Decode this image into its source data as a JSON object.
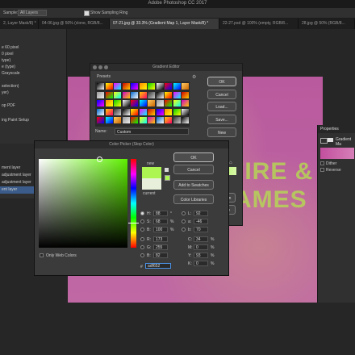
{
  "app": {
    "title": "Adobe Photoshop CC 2017",
    "options_bar": {
      "sample_label": "Sample:",
      "sample_value": "All Layers",
      "show_ring_label": "Show Sampling Ring"
    },
    "tabs": [
      "2, Layer Mask/8) *",
      "04-06.jpg @ 50% (clone, RGB/8...",
      "07-21.jpg @ 33.3% (Gradient Map 1, Layer Mask/8) *",
      "22-27.psd @ 100% (empty, RGB/8...",
      "28.jpg @ 50% (RGB/8..."
    ]
  },
  "left_panel": {
    "items": [
      "e 60 pixel",
      "0 pixel",
      "type)",
      "e (type)",
      "Grayscale",
      "selection)",
      "yer)",
      "op PDF",
      "ing Paint Setup"
    ],
    "layers": [
      "ment layer",
      "adjustment layer",
      "adjustment layer",
      "ent layer"
    ]
  },
  "canvas": {
    "text_line1": "FIRE &",
    "text_line2": "AMES",
    "colors": {
      "bg_top": "#b95a9e",
      "bg_bottom": "#bf68a4",
      "text": "#b6cf5a"
    }
  },
  "gradient_editor": {
    "title": "Gradient Editor",
    "presets_label": "Presets",
    "name_label": "Name:",
    "name_value": "Custom",
    "buttons": {
      "ok": "OK",
      "cancel": "Cancel",
      "load": "Load...",
      "save": "Save...",
      "new": "New"
    },
    "partial_buttons": {
      "delete": "lete",
      "location": "ation"
    }
  },
  "properties": {
    "title": "Properties",
    "item": "Gradient Ma",
    "dither": "Dither",
    "reverse": "Reverse"
  },
  "color_picker": {
    "title": "Color Picker (Stop Color)",
    "new_label": "new",
    "current_label": "current",
    "new_color": "#adf652",
    "current_color": "#e8f0dc",
    "buttons": {
      "ok": "OK",
      "cancel": "Cancel",
      "add_swatches": "Add to Swatches",
      "color_libraries": "Color Libraries"
    },
    "only_web_colors": "Only Web Colors",
    "fields": {
      "H": "88",
      "S": "68",
      "B": "100",
      "R": "173",
      "G": "255",
      "Bl": "82",
      "L": "92",
      "a": "-46",
      "b": "70",
      "C": "34",
      "M": "0",
      "Y": "93",
      "K": "0"
    },
    "units": {
      "deg": "°",
      "pct": "%"
    },
    "hex_label": "#",
    "hex_value": "adf652"
  }
}
